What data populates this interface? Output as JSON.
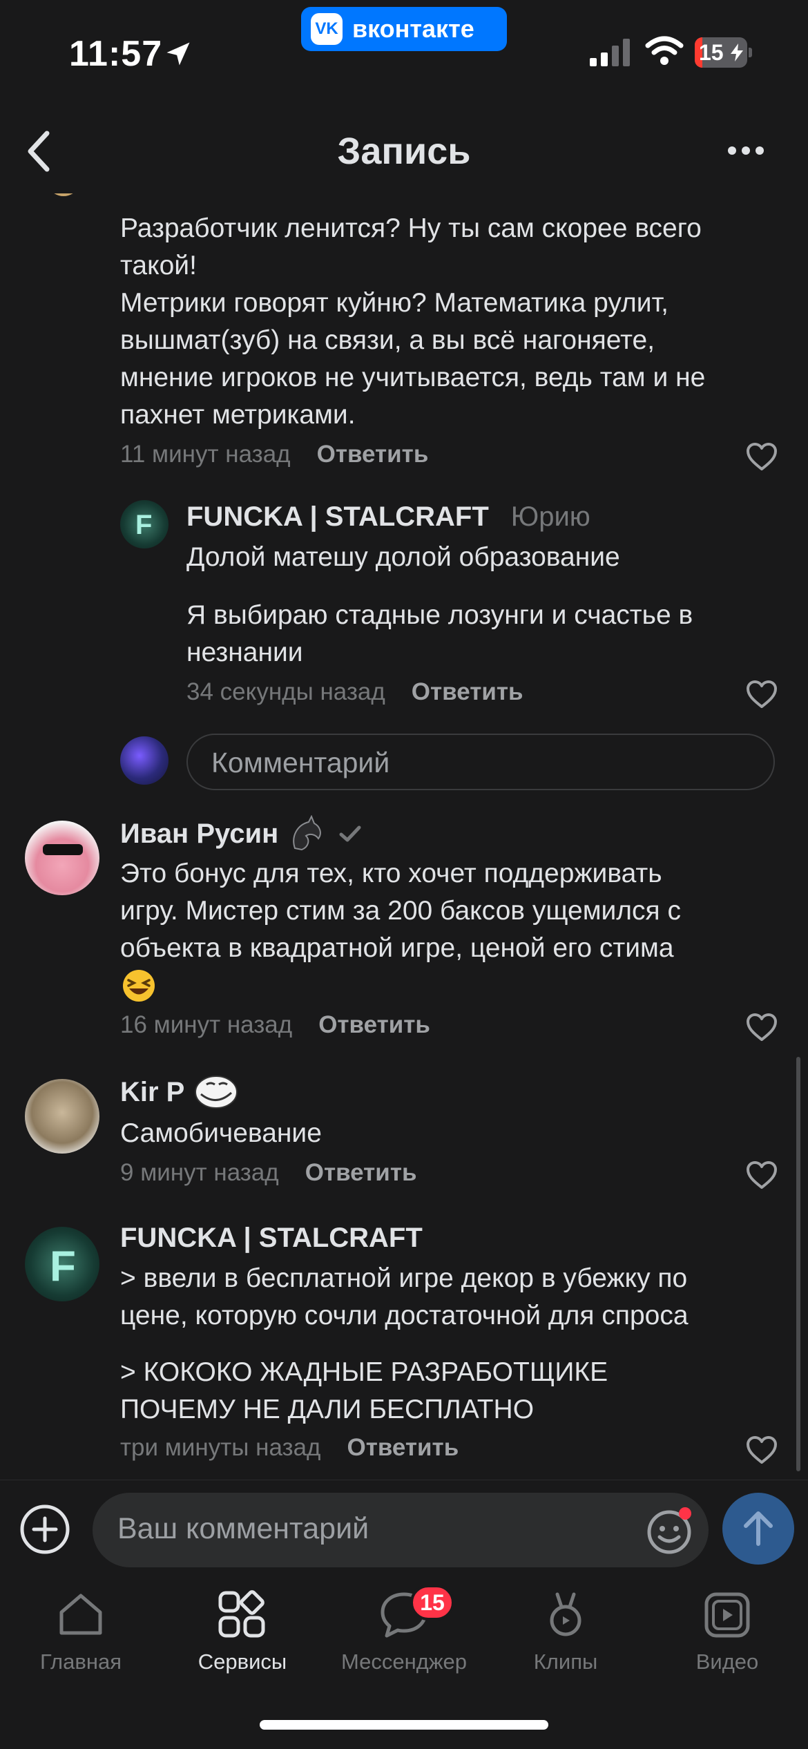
{
  "status_bar": {
    "time": "11:57",
    "badge_label": "вконтакте",
    "battery": "15",
    "battery_level": 0.15,
    "icons": [
      "location-arrow-icon",
      "vk-logo",
      "cellular-signal-icon",
      "wifi-icon",
      "battery-charging-icon"
    ]
  },
  "header": {
    "title": "Запись",
    "back_icon": "chevron-left-icon",
    "more_icon": "more-horizontal-icon"
  },
  "comments": [
    {
      "text_lines": [
        "Разработчик ленится? Ну ты сам скорее всего",
        "такой!",
        "Метрики говорят куйню? Математика рулит,",
        "вышмат(зуб) на связи, а вы всё нагоняете,",
        "мнение игроков не учитывается, ведь там и не",
        "пахнет метриками."
      ],
      "time": "11 минут назад",
      "reply_label": "Ответить"
    },
    {
      "author": "FUNCKA | STALCRAFT",
      "reply_to": "Юрию",
      "text_lines": [
        "Долой матешу долой образование"
      ],
      "text_lines_2": [
        "Я выбираю стадные лозунги и счастье в",
        "незнании"
      ],
      "time": "34 секунды назад",
      "reply_label": "Ответить"
    },
    {
      "author": "Иван Русин",
      "text_lines": [
        "Это бонус для тех, кто хочет поддерживать",
        "игру. Мистер стим за 200 баксов ущемился с",
        "объекта в квадратной игре, ценой его стима"
      ],
      "time": "16 минут назад",
      "reply_label": "Ответить"
    },
    {
      "author": "Kir P",
      "text_lines": [
        "Самобичевание"
      ],
      "time": "9 минут назад",
      "reply_label": "Ответить"
    },
    {
      "author": "FUNCKA | STALCRAFT",
      "text_lines": [
        "> ввели в бесплатной игре декор в убежку по",
        "цене, которую сочли достаточной для спроса"
      ],
      "text_lines_2": [
        "> КОКОКО ЖАДНЫЕ РАЗРАБОТЩИКЕ",
        "ПОЧЕМУ НЕ ДАЛИ БЕСПЛАТНО"
      ],
      "time": "три минуты назад",
      "reply_label": "Ответить"
    }
  ],
  "inline_reply": {
    "placeholder": "Комментарий"
  },
  "composer": {
    "placeholder": "Ваш комментарий"
  },
  "tabbar": {
    "tabs": [
      {
        "label": "Главная",
        "icon": "home-icon"
      },
      {
        "label": "Сервисы",
        "icon": "services-grid-icon"
      },
      {
        "label": "Мессенджер",
        "icon": "chat-bubble-icon",
        "badge": "15"
      },
      {
        "label": "Клипы",
        "icon": "clips-icon"
      },
      {
        "label": "Видео",
        "icon": "video-icon"
      }
    ],
    "active": "Сервисы"
  },
  "colors": {
    "background": "#19191a",
    "text": "#e1e3e6",
    "secondary": "#76787a",
    "vk_blue": "#0077ff",
    "badge_red": "#ff3347"
  }
}
